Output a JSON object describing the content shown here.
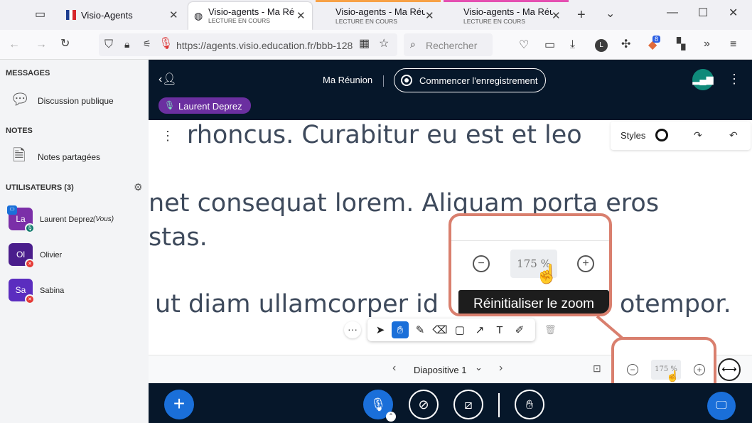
{
  "browser": {
    "tabs": [
      {
        "title": "Visio-Agents",
        "sub": ""
      },
      {
        "title": "Visio-agents - Ma Réunion",
        "sub": "LECTURE EN COURS"
      },
      {
        "title": "Visio-agents - Ma Réunion",
        "sub": "LECTURE EN COURS"
      },
      {
        "title": "Visio-agents - Ma Réunion",
        "sub": "LECTURE EN COURS"
      }
    ],
    "tab_colors": [
      "#000000",
      "#f7a146",
      "#e54fb1"
    ],
    "url": "https://agents.visio.education.fr/bbb-128",
    "search_placeholder": "Rechercher",
    "extension_badge": "8"
  },
  "sidebar": {
    "messages_title": "MESSAGES",
    "public_chat": "Discussion publique",
    "notes_title": "NOTES",
    "shared_notes": "Notes partagées",
    "users_title": "UTILISATEURS (3)",
    "users": [
      {
        "initials": "La",
        "name": "Laurent Deprez",
        "suffix": "(Vous)",
        "color": "#7b2fa8",
        "badge_color": "#0f7b6c"
      },
      {
        "initials": "Ol",
        "name": "Olivier",
        "suffix": "",
        "color": "#4a1d8c",
        "badge_color": "#e53935"
      },
      {
        "initials": "Sa",
        "name": "Sabina",
        "suffix": "",
        "color": "#5b2dbf",
        "badge_color": "#e53935"
      }
    ]
  },
  "meeting": {
    "title": "Ma Réunion",
    "record_label": "Commencer l'enregistrement",
    "speaker": "Laurent Deprez",
    "styles_label": "Styles",
    "slide_lines": [
      "or rhoncus. Curabitur eu est et leo",
      "net consequat lorem. Aliquam porta eros",
      "stas.",
      "ut diam ullamcorper id",
      "otempor."
    ],
    "slide_selector": "Diapositive 1",
    "zoom_value": "175 %",
    "zoom_tooltip": "Réinitialiser le zoom"
  },
  "colors": {
    "accent": "#1a6fd9",
    "dark": "#06172a",
    "callout": "#d97f6e",
    "speaker_pill": "#6b2fa0"
  }
}
